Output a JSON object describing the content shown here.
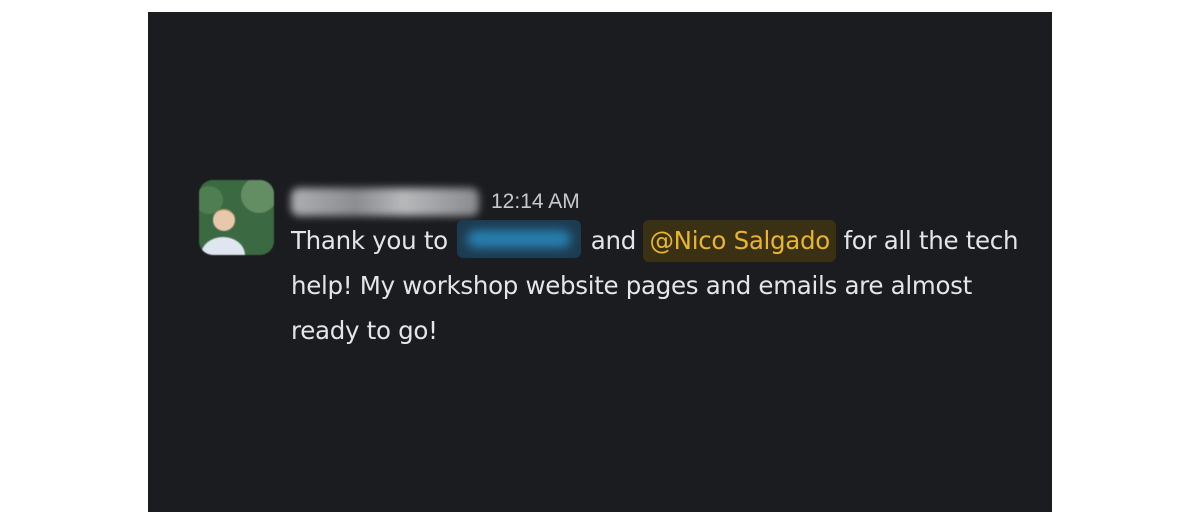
{
  "message": {
    "sender_name": "",
    "timestamp": "12:14 AM",
    "text_before": "Thank you to ",
    "text_between": " and ",
    "mention_user": "@Nico Salgado",
    "text_after": " for all the tech help! My workshop website pages and emails are almost ready to go!"
  },
  "colors": {
    "background": "#1b1c20",
    "text": "#e4e5e7",
    "mention_text": "#e8b52c",
    "mention_background": "#3a3115",
    "redacted_mention_color": "#2a8fc6"
  }
}
